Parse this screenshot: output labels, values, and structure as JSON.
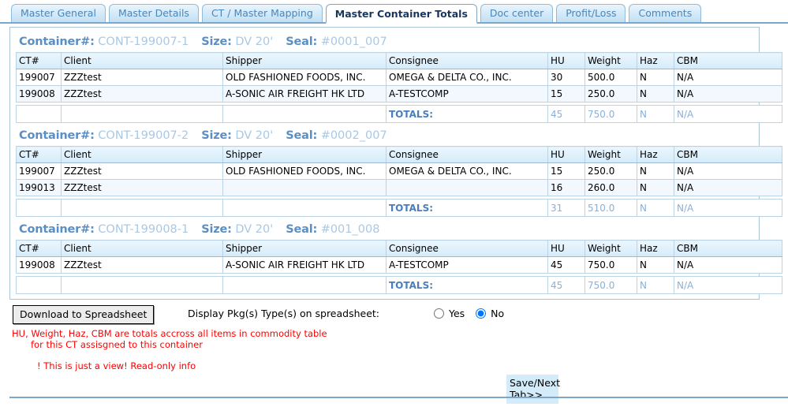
{
  "tabs": [
    {
      "label": "Master General",
      "active": false
    },
    {
      "label": "Master Details",
      "active": false
    },
    {
      "label": "CT / Master Mapping",
      "active": false
    },
    {
      "label": "Master Container Totals",
      "active": true
    },
    {
      "label": "Doc center",
      "active": false
    },
    {
      "label": "Profit/Loss",
      "active": false
    },
    {
      "label": "Comments",
      "active": false
    }
  ],
  "labels": {
    "container_label": "Container#:",
    "size_label": "Size:",
    "seal_label": "Seal:",
    "totals_label": "TOTALS:"
  },
  "columns": {
    "ct": "CT#",
    "client": "Client",
    "shipper": "Shipper",
    "consignee": "Consignee",
    "hu": "HU",
    "weight": "Weight",
    "haz": "Haz",
    "cbm": "CBM"
  },
  "containers": [
    {
      "container_no": "CONT-199007-1",
      "size": "DV  20'",
      "seal": "#0001_007",
      "rows": [
        {
          "ct": "199007",
          "client": "ZZZtest",
          "shipper": "OLD FASHIONED FOODS, INC.",
          "consignee": "OMEGA & DELTA CO., INC.",
          "hu": "30",
          "weight": "500.0",
          "haz": "N",
          "cbm": "N/A"
        },
        {
          "ct": "199008",
          "client": "ZZZtest",
          "shipper": "A-SONIC AIR FREIGHT HK LTD",
          "consignee": "A-TESTCOMP",
          "hu": "15",
          "weight": "250.0",
          "haz": "N",
          "cbm": "N/A"
        }
      ],
      "totals": {
        "hu": "45",
        "weight": "750.0",
        "haz": "N",
        "cbm": "N/A"
      }
    },
    {
      "container_no": "CONT-199007-2",
      "size": "DV  20'",
      "seal": "#0002_007",
      "rows": [
        {
          "ct": "199007",
          "client": "ZZZtest",
          "shipper": "OLD FASHIONED FOODS, INC.",
          "consignee": "OMEGA & DELTA CO., INC.",
          "hu": "15",
          "weight": "250.0",
          "haz": "N",
          "cbm": "N/A"
        },
        {
          "ct": "199013",
          "client": "ZZZtest",
          "shipper": "",
          "consignee": "",
          "hu": "16",
          "weight": "260.0",
          "haz": "N",
          "cbm": "N/A"
        }
      ],
      "totals": {
        "hu": "31",
        "weight": "510.0",
        "haz": "N",
        "cbm": "N/A"
      }
    },
    {
      "container_no": "CONT-199008-1",
      "size": "DV  20'",
      "seal": "#001_008",
      "rows": [
        {
          "ct": "199008",
          "client": "ZZZtest",
          "shipper": "A-SONIC AIR FREIGHT HK LTD",
          "consignee": "A-TESTCOMP",
          "hu": "45",
          "weight": "750.0",
          "haz": "N",
          "cbm": "N/A"
        }
      ],
      "totals": {
        "hu": "45",
        "weight": "750.0",
        "haz": "N",
        "cbm": "N/A"
      }
    }
  ],
  "bottom": {
    "download_button": "Download to Spreadsheet",
    "pkg_question": "Display Pkg(s) Type(s) on spreadsheet:",
    "radio_yes": "Yes",
    "radio_no": "No",
    "radio_selected": "No",
    "note_line1": "HU, Weight, Haz, CBM are totals accross all items in commodity table",
    "note_line2": "for this CT assisgned to this container",
    "note_readonly": "! This is just a view! Read-only info",
    "save_button": "Save/Next Tab>>"
  },
  "colors": {
    "tab_active_text": "#17365d",
    "tab_inactive_text": "#4b86b8",
    "header_label": "#5b8fc4",
    "header_value": "#a9c8e4",
    "totals_label": "#4a7ebb",
    "totals_value": "#8ab0d9",
    "warning_text": "#ff0000",
    "panel_border": "#a8c4d8"
  }
}
